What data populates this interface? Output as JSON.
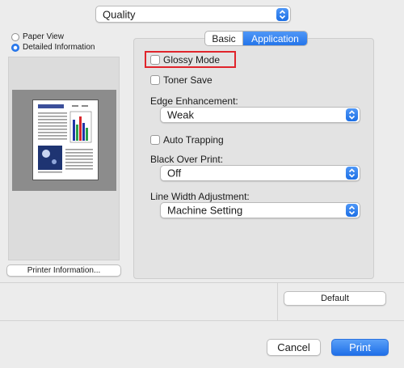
{
  "quality_popup": {
    "value": "Quality"
  },
  "view_options": [
    {
      "label": "Paper View",
      "selected": false
    },
    {
      "label": "Detailed Information",
      "selected": true
    }
  ],
  "printer_info_button": "Printer Information...",
  "tabs": [
    {
      "label": "Basic",
      "selected": false
    },
    {
      "label": "Application",
      "selected": true
    }
  ],
  "options": {
    "glossy_mode": {
      "label": "Glossy Mode",
      "checked": false,
      "highlighted": true
    },
    "toner_save": {
      "label": "Toner Save",
      "checked": false
    },
    "edge_enhancement": {
      "label": "Edge Enhancement:",
      "value": "Weak"
    },
    "auto_trapping": {
      "label": "Auto Trapping",
      "checked": false
    },
    "black_over_print": {
      "label": "Black Over Print:",
      "value": "Off"
    },
    "line_width_adjustment": {
      "label": "Line Width Adjustment:",
      "value": "Machine Setting"
    }
  },
  "default_button": "Default",
  "footer": {
    "cancel": "Cancel",
    "print": "Print"
  },
  "colors": {
    "accent": "#2475ea",
    "highlight_box": "#e0242b"
  }
}
